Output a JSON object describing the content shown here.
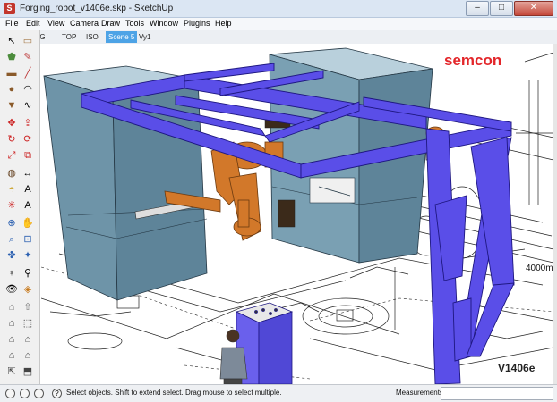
{
  "window": {
    "title": "Forging_robot_v1406e.skp - SketchUp",
    "app_icon": "sketchup-icon"
  },
  "menu": [
    "File",
    "Edit",
    "View",
    "Camera",
    "Draw",
    "Tools",
    "Window",
    "Plugins",
    "Help"
  ],
  "scenes": {
    "tabs": [
      "DWG",
      "TOP",
      "ISO",
      "Scene 5",
      "Vy1"
    ],
    "active": "Scene 5"
  },
  "viewport": {
    "brand": "semcon",
    "version_label": "V1406e",
    "dimension_label": "4000m"
  },
  "status": {
    "hint": "Select objects. Shift to extend select. Drag mouse to select multiple.",
    "measurements_label": "Measurements",
    "measurements_value": ""
  },
  "colors": {
    "frame": "#5a4ee8",
    "blocks": "#6e94a8",
    "robot": "#d2782a",
    "brand": "#e3262a"
  },
  "tools": [
    "select-icon",
    "eraser-icon",
    "paint-bucket-icon",
    "pencil-icon",
    "rectangle-icon",
    "line-icon",
    "circle-icon",
    "arc-icon",
    "polygon-icon",
    "freehand-icon",
    "move-icon",
    "push-pull-icon",
    "rotate-icon",
    "follow-me-icon",
    "scale-icon",
    "offset-icon",
    "tape-measure-icon",
    "dimension-icon",
    "protractor-icon",
    "text-icon",
    "axes-icon",
    "3d-text-icon",
    "orbit-icon",
    "pan-icon",
    "zoom-icon",
    "zoom-window-icon",
    "zoom-extents-icon",
    "previous-view-icon",
    "position-camera-icon",
    "walk-icon",
    "look-around-icon",
    "section-plane-icon",
    "warehouse-icon",
    "share-model-icon",
    "components-icon",
    "extensions-icon",
    "home-view-icon",
    "front-view-icon",
    "left-view-icon",
    "right-view-icon",
    "back-view-icon",
    "bottom-view-icon"
  ]
}
